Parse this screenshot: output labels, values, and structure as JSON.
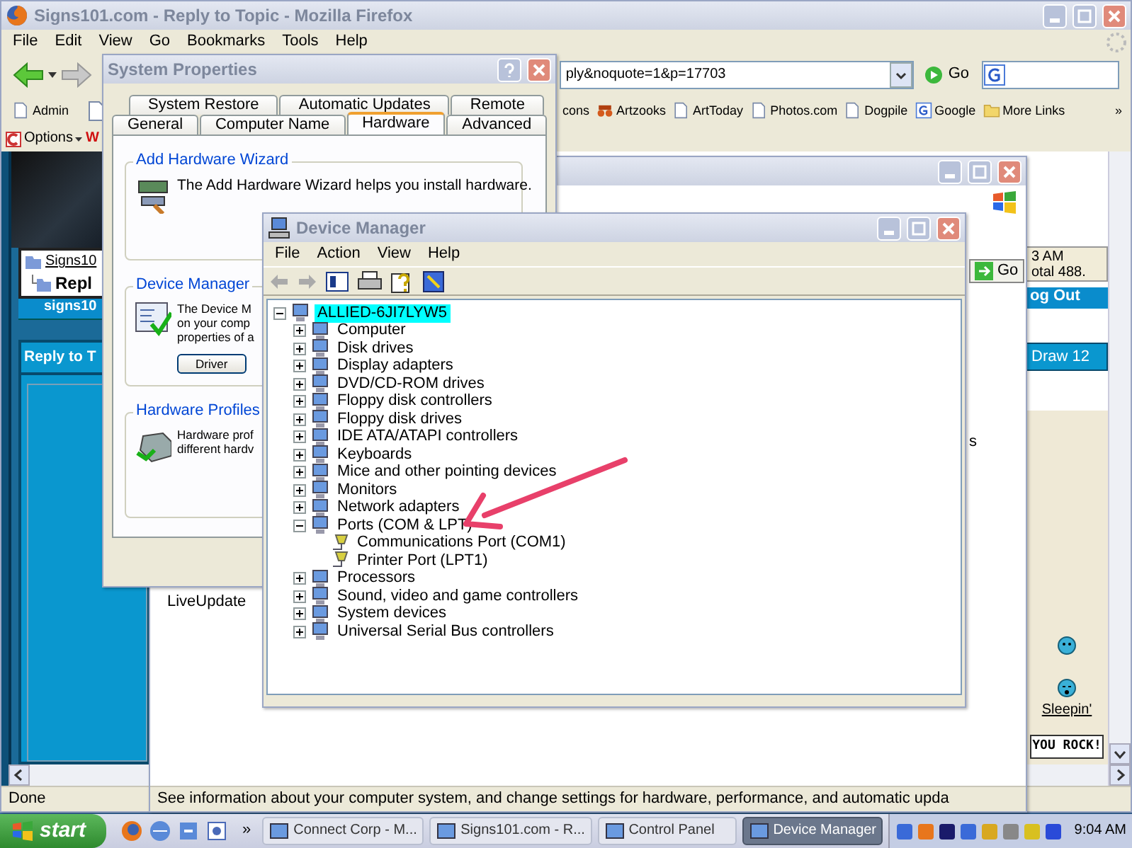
{
  "firefox": {
    "title": "Signs101.com - Reply to Topic - Mozilla Firefox",
    "menu": [
      "File",
      "Edit",
      "View",
      "Go",
      "Bookmarks",
      "Tools",
      "Help"
    ],
    "address": "ply&noquote=1&p=17703",
    "go": "Go",
    "bookmarks": [
      {
        "label": "Admin",
        "kind": "page"
      },
      {
        "label": "cons",
        "kind": "plain"
      },
      {
        "label": "Artzooks",
        "kind": "binoculars"
      },
      {
        "label": "ArtToday",
        "kind": "page"
      },
      {
        "label": "Photos.com",
        "kind": "page"
      },
      {
        "label": "Dogpile",
        "kind": "page"
      },
      {
        "label": "Google",
        "kind": "search"
      },
      {
        "label": "More Links",
        "kind": "folder"
      }
    ],
    "chevron": "»",
    "options": "Options",
    "extension_letter": "W",
    "page": {
      "breadcrumb_link": "Signs10",
      "breadcrumb_current": "Repl",
      "bar": "signs10",
      "heading": "Reply to T",
      "go": "Go",
      "time": "3 AM",
      "total": "otal 488.",
      "logout": "og Out",
      "draw": "Draw 12",
      "fragment": "s",
      "smiley_label": "Sleepin'",
      "banner_text": "YOU ROCK!"
    },
    "status": "Done"
  },
  "control_panel": {
    "item": "LiveUpdate",
    "status": "See information about your computer system, and change settings for hardware, performance, and automatic upda"
  },
  "system_properties": {
    "title": "System Properties",
    "tab_rows": [
      [
        {
          "label": "System Restore",
          "selected": false
        },
        {
          "label": "Automatic Updates",
          "selected": false
        },
        {
          "label": "Remote",
          "selected": false
        }
      ],
      [
        {
          "label": "General",
          "selected": false
        },
        {
          "label": "Computer Name",
          "selected": false
        },
        {
          "label": "Hardware",
          "selected": true
        },
        {
          "label": "Advanced",
          "selected": false
        }
      ]
    ],
    "groups": [
      {
        "title": "Add Hardware Wizard",
        "lines": [
          "The Add Hardware Wizard helps you install hardware."
        ]
      },
      {
        "title": "Device Manager",
        "lines": [
          "The Device M",
          "on your comp",
          "properties of a"
        ],
        "button": "Driver"
      },
      {
        "title": "Hardware Profiles",
        "lines": [
          "Hardware prof",
          "different hardv"
        ]
      }
    ]
  },
  "device_manager": {
    "title": "Device Manager",
    "menu": [
      "File",
      "Action",
      "View",
      "Help"
    ],
    "tree": [
      {
        "label": "ALLIED-6JI7LYW5",
        "selected": true,
        "expanded": true,
        "children": [
          {
            "label": "Computer",
            "selected": false,
            "expanded": false
          },
          {
            "label": "Disk drives",
            "selected": false,
            "expanded": false
          },
          {
            "label": "Display adapters",
            "selected": false,
            "expanded": false
          },
          {
            "label": "DVD/CD-ROM drives",
            "selected": false,
            "expanded": false
          },
          {
            "label": "Floppy disk controllers",
            "selected": false,
            "expanded": false
          },
          {
            "label": "Floppy disk drives",
            "selected": false,
            "expanded": false
          },
          {
            "label": "IDE ATA/ATAPI controllers",
            "selected": false,
            "expanded": false
          },
          {
            "label": "Keyboards",
            "selected": false,
            "expanded": false
          },
          {
            "label": "Mice and other pointing devices",
            "selected": false,
            "expanded": false
          },
          {
            "label": "Monitors",
            "selected": false,
            "expanded": false
          },
          {
            "label": "Network adapters",
            "selected": false,
            "expanded": false
          },
          {
            "label": "Ports (COM & LPT)",
            "selected": false,
            "expanded": true,
            "children": [
              {
                "label": "Communications Port (COM1)",
                "selected": false
              },
              {
                "label": "Printer Port (LPT1)",
                "selected": false
              }
            ]
          },
          {
            "label": "Processors",
            "selected": false,
            "expanded": false
          },
          {
            "label": "Sound, video and game controllers",
            "selected": false,
            "expanded": false
          },
          {
            "label": "System devices",
            "selected": false,
            "expanded": false
          },
          {
            "label": "Universal Serial Bus controllers",
            "selected": false,
            "expanded": false
          }
        ]
      }
    ]
  },
  "taskbar": {
    "start": "start",
    "chevron": "»",
    "tasks": [
      {
        "label": "Connect Corp - M...",
        "selected": false
      },
      {
        "label": "Signs101.com - R...",
        "selected": false
      },
      {
        "label": "Control Panel",
        "selected": false
      },
      {
        "label": "Device Manager",
        "selected": true
      }
    ],
    "clock": "9:04 AM"
  }
}
